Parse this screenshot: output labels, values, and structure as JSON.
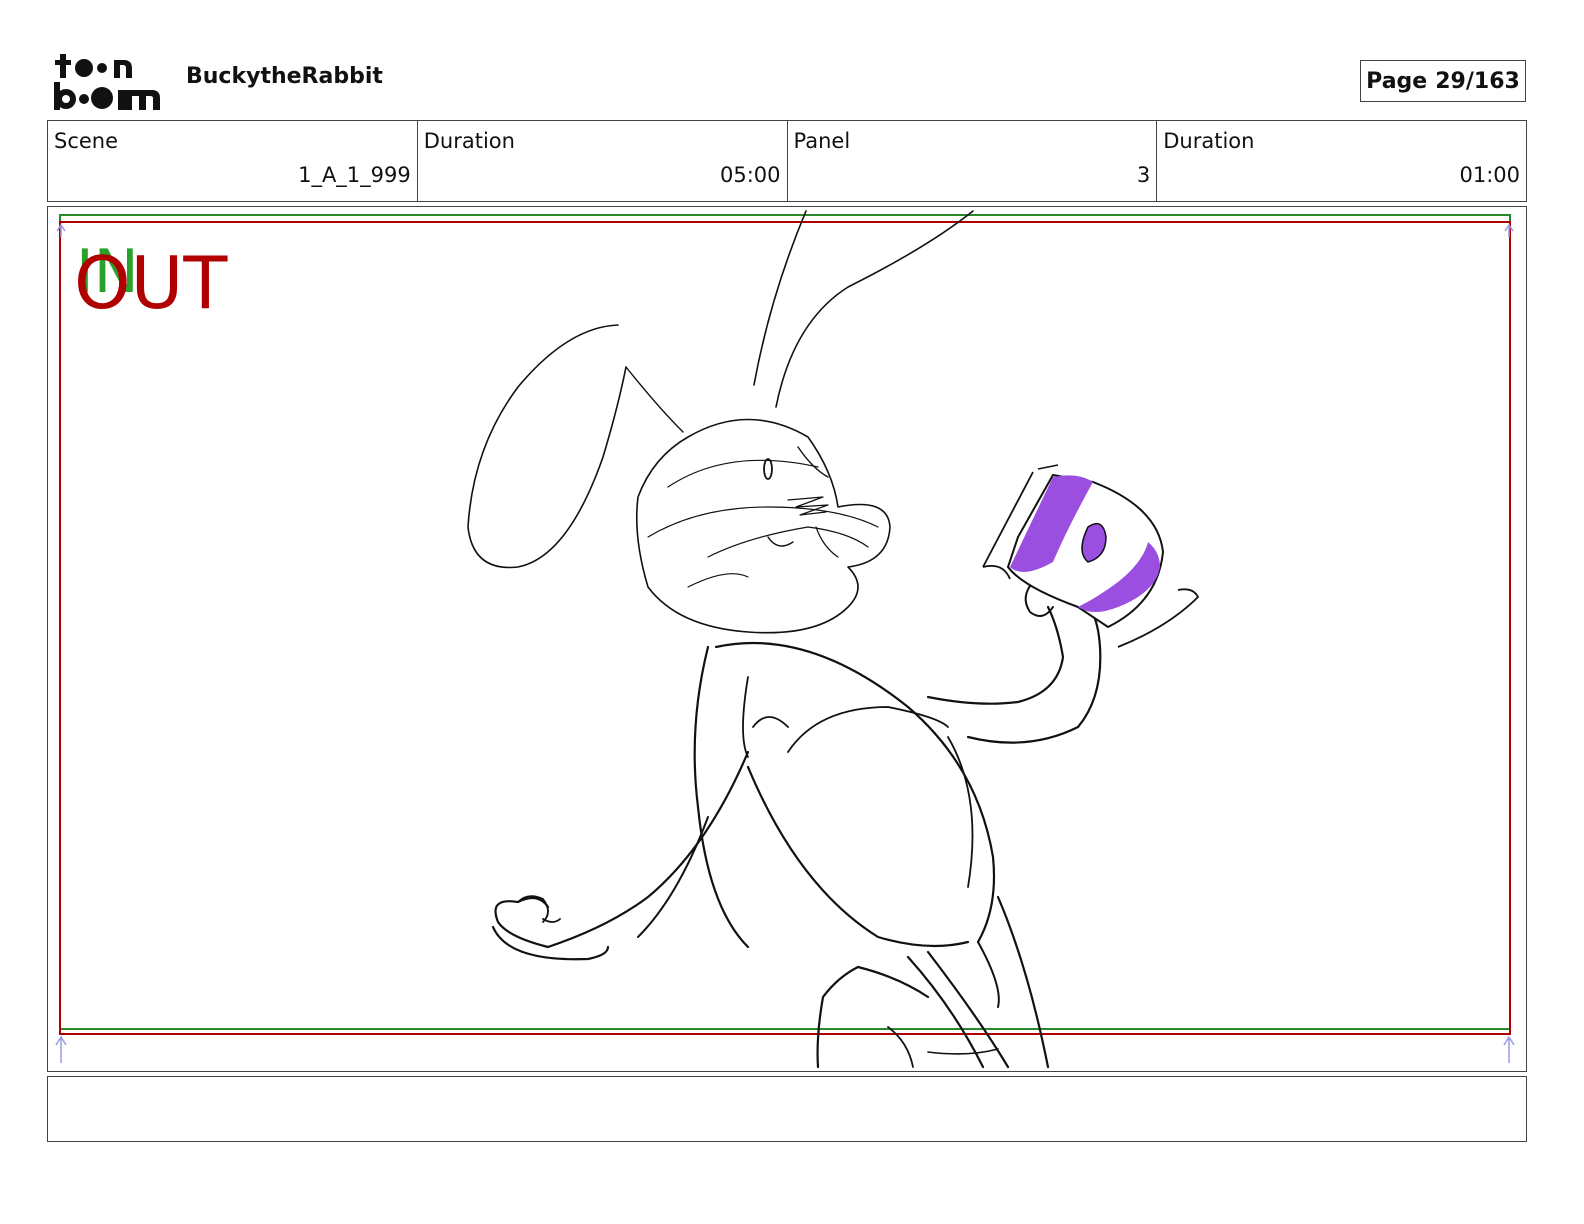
{
  "header": {
    "logo_text": "toon boom",
    "project_title": "BuckytheRabbit",
    "page_label": "Page",
    "page_number": "29/163"
  },
  "info": {
    "scene_label": "Scene",
    "scene_value": "1_A_1_999",
    "scene_duration_label": "Duration",
    "scene_duration_value": "05:00",
    "panel_label": "Panel",
    "panel_value": "3",
    "panel_duration_label": "Duration",
    "panel_duration_value": "01:00"
  },
  "panel": {
    "in_label": "IN",
    "out_label": "OUT",
    "colors": {
      "safe_frame": "#2a8a2a",
      "action_frame": "#b00000",
      "cup_fill": "#9b4fe0",
      "marker": "#9a9ae8"
    }
  },
  "notes": {
    "text": ""
  }
}
